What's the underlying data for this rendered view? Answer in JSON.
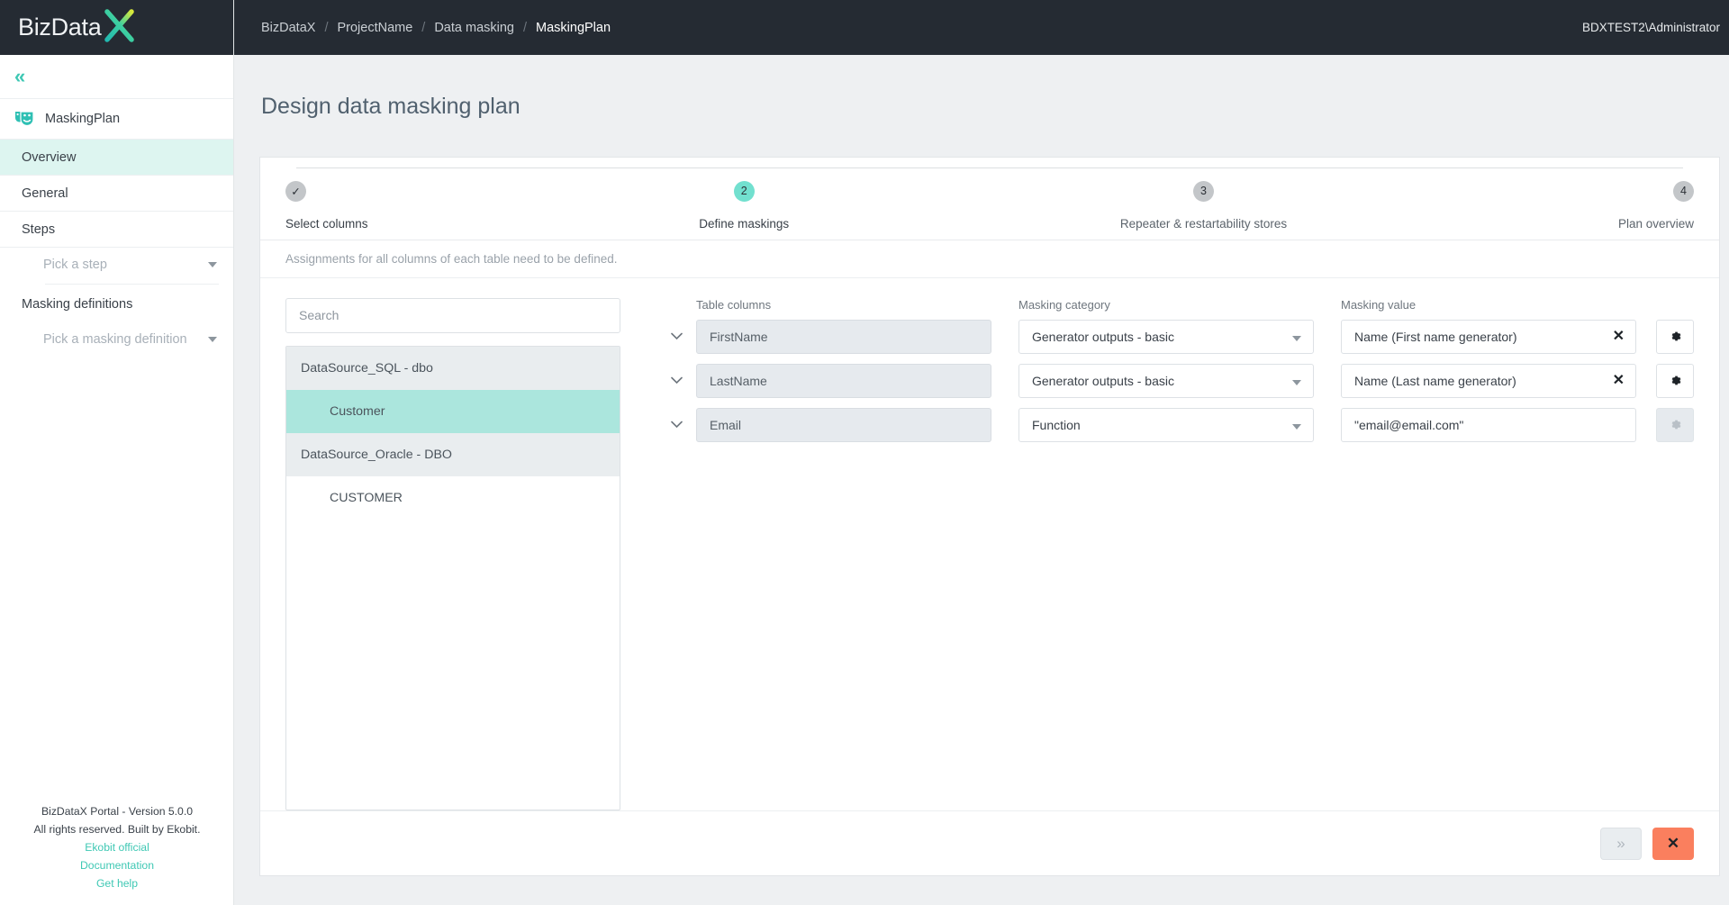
{
  "brand": {
    "name": "BizDataX",
    "logo_text_a": "BizData",
    "logo_text_x": "X"
  },
  "topbar": {
    "breadcrumb": [
      "BizDataX",
      "ProjectName",
      "Data masking",
      "MaskingPlan"
    ],
    "separator": "/",
    "user": "BDXTEST2\\Administrator"
  },
  "sidebar": {
    "collapse_icon": "«",
    "plan": {
      "icon": "masks-icon",
      "label": "MaskingPlan"
    },
    "items": [
      {
        "label": "Overview",
        "active": true
      },
      {
        "label": "General",
        "active": false
      },
      {
        "label": "Steps",
        "active": false
      }
    ],
    "step_picker": {
      "placeholder": "Pick a step"
    },
    "definitions_label": "Masking definitions",
    "definition_picker": {
      "placeholder": "Pick a masking definition"
    },
    "footer": {
      "version": "BizDataX Portal - Version 5.0.0",
      "rights": "All rights reserved. Built by Ekobit.",
      "links": [
        "Ekobit official",
        "Documentation",
        "Get help"
      ]
    }
  },
  "page": {
    "title": "Design data masking plan"
  },
  "stepper": {
    "steps": [
      {
        "number": "✓",
        "label": "Select columns",
        "state": "done"
      },
      {
        "number": "2",
        "label": "Define maskings",
        "state": "active"
      },
      {
        "number": "3",
        "label": "Repeater & restartability stores",
        "state": "pending"
      },
      {
        "number": "4",
        "label": "Plan overview",
        "state": "pending"
      }
    ]
  },
  "hint": "Assignments for all columns of each table need to be defined.",
  "search": {
    "placeholder": "Search",
    "value": ""
  },
  "tree": {
    "nodes": [
      {
        "label": "DataSource_SQL - dbo",
        "type": "group",
        "selected": false
      },
      {
        "label": "Customer",
        "type": "child",
        "selected": true
      },
      {
        "label": "DataSource_Oracle - DBO",
        "type": "group",
        "selected": false
      },
      {
        "label": "CUSTOMER",
        "type": "child",
        "selected": false
      }
    ]
  },
  "form": {
    "headers": {
      "columns": "Table columns",
      "category": "Masking category",
      "value": "Masking value"
    },
    "rows": [
      {
        "column": "FirstName",
        "category": "Generator outputs - basic",
        "value": "Name (First name generator)",
        "has_clear": true,
        "settings_enabled": true
      },
      {
        "column": "LastName",
        "category": "Generator outputs - basic",
        "value": "Name (Last name generator)",
        "has_clear": true,
        "settings_enabled": true
      },
      {
        "column": "Email",
        "category": "Function",
        "value": "\"email@email.com\"",
        "has_clear": false,
        "settings_enabled": false
      }
    ],
    "clear_icon": "✕",
    "settings_icon": "gear-icon",
    "expand_icon": "chevron-down-icon"
  },
  "actions": {
    "next_label": "»",
    "cancel_label": "✕"
  },
  "colors": {
    "accent_teal": "#3fc8b4",
    "active_step": "#72e0cf",
    "selection": "#abe6dd",
    "sidebar_active": "#ddf5f0",
    "dark": "#252b33",
    "cancel": "#fa7f5e"
  }
}
